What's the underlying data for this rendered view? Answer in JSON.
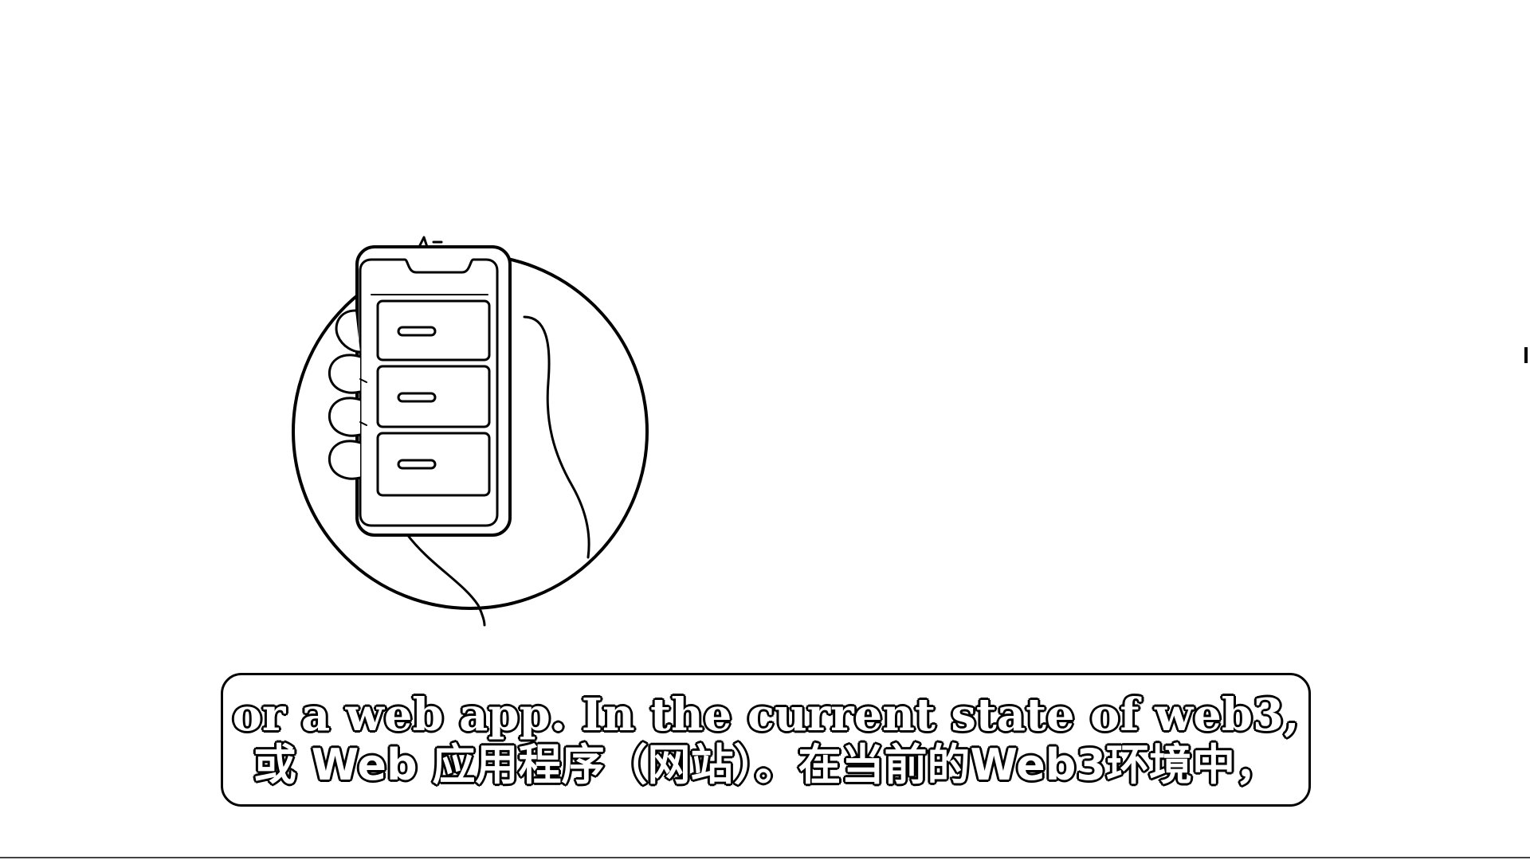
{
  "subtitles": {
    "english": "or a web app. In the current state of web3,",
    "chinese": "或 Web 应用程序（网站）。在当前的Web3环境中，"
  },
  "illustration": {
    "icon": "hand-holding-phone-icon"
  }
}
